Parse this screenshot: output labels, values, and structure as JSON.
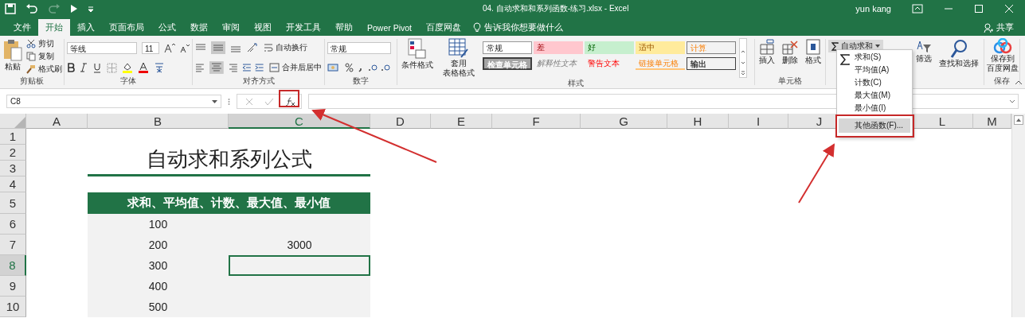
{
  "window": {
    "title": "04. 自动求和和系列函数-练习.xlsx  -  Excel",
    "user": "yun kang"
  },
  "tabs": [
    {
      "label": "文件",
      "selected": false
    },
    {
      "label": "开始",
      "selected": true
    },
    {
      "label": "插入",
      "selected": false
    },
    {
      "label": "页面布局",
      "selected": false
    },
    {
      "label": "公式",
      "selected": false
    },
    {
      "label": "数据",
      "selected": false
    },
    {
      "label": "审阅",
      "selected": false
    },
    {
      "label": "视图",
      "selected": false
    },
    {
      "label": "开发工具",
      "selected": false
    },
    {
      "label": "帮助",
      "selected": false
    },
    {
      "label": "Power Pivot",
      "selected": false
    },
    {
      "label": "百度网盘",
      "selected": false
    }
  ],
  "tell_me": "告诉我你想要做什么",
  "share": "共享",
  "ribbon": {
    "clipboard": {
      "label": "剪贴板",
      "paste": "粘贴",
      "cut": "剪切",
      "copy": "复制",
      "format_painter": "格式刷"
    },
    "font": {
      "label": "字体",
      "font_name": "等线",
      "font_size": "11"
    },
    "alignment": {
      "label": "对齐方式",
      "wrap": "自动换行",
      "merge": "合并后居中"
    },
    "number": {
      "label": "数字",
      "format": "常规"
    },
    "styles": {
      "label": "样式",
      "conditional": [
        "条件格式"
      ],
      "table": [
        "套用",
        "表格格式"
      ],
      "gallery": [
        {
          "label": "常规",
          "kind": "normal"
        },
        {
          "label": "差",
          "kind": "bad"
        },
        {
          "label": "好",
          "kind": "good"
        },
        {
          "label": "适中",
          "kind": "neutral"
        },
        {
          "label": "计算",
          "kind": "calculation"
        },
        {
          "label": "检查单元格",
          "kind": "check"
        },
        {
          "label": "解释性文本",
          "kind": "explanatory"
        },
        {
          "label": "警告文本",
          "kind": "warning"
        },
        {
          "label": "链接单元格",
          "kind": "linked"
        },
        {
          "label": "输出",
          "kind": "output"
        }
      ]
    },
    "cells": {
      "label": "单元格",
      "insert": "插入",
      "delete": "删除",
      "format": "格式"
    },
    "editing": {
      "autosum": "自动求和",
      "sort": "筛选",
      "find": "查找和选择"
    },
    "save": {
      "label": "保存",
      "lines": [
        "保存到",
        "百度网盘"
      ]
    }
  },
  "autosum_menu": [
    {
      "label": "求和(S)",
      "selected": false
    },
    {
      "label": "平均值(A)",
      "selected": false
    },
    {
      "label": "计数(C)",
      "selected": false
    },
    {
      "label": "最大值(M)",
      "selected": false
    },
    {
      "label": "最小值(I)",
      "selected": false
    },
    {
      "label": "其他函数(F)...",
      "selected": true
    }
  ],
  "formula_bar": {
    "name_box": "C8"
  },
  "sheet": {
    "columns": [
      {
        "label": "A",
        "selected": false
      },
      {
        "label": "B",
        "selected": false
      },
      {
        "label": "C",
        "selected": true
      },
      {
        "label": "D",
        "selected": false
      },
      {
        "label": "E",
        "selected": false
      },
      {
        "label": "F",
        "selected": false
      },
      {
        "label": "G",
        "selected": false
      },
      {
        "label": "H",
        "selected": false
      },
      {
        "label": "I",
        "selected": false
      },
      {
        "label": "J",
        "selected": false
      },
      {
        "label": "L",
        "selected": false
      },
      {
        "label": "M",
        "selected": false
      }
    ],
    "rows": [
      {
        "label": "1",
        "selected": false
      },
      {
        "label": "2",
        "selected": false
      },
      {
        "label": "3",
        "selected": false
      },
      {
        "label": "4",
        "selected": false
      },
      {
        "label": "5",
        "selected": false
      },
      {
        "label": "6",
        "selected": false
      },
      {
        "label": "7",
        "selected": false
      },
      {
        "label": "8",
        "selected": true
      },
      {
        "label": "9",
        "selected": false
      },
      {
        "label": "10",
        "selected": false
      }
    ],
    "title": "自动求和系列公式",
    "header": "求和、平均值、计数、最大值、最小值",
    "values": [
      "100",
      "200",
      "300",
      "400",
      "500"
    ],
    "result": "3000"
  }
}
